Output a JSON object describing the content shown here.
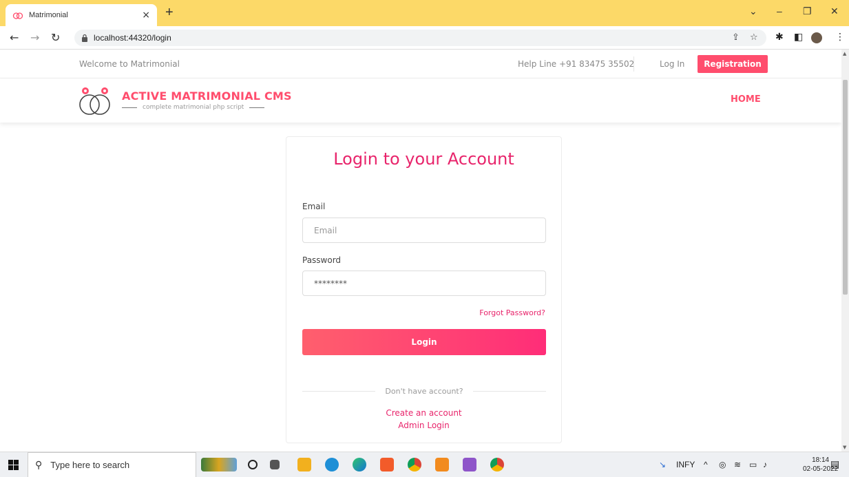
{
  "browser": {
    "tab_title": "Matrimonial",
    "tab_close": "×",
    "new_tab": "+",
    "url": "localhost:44320/login",
    "win_minimize_chevron": "⌄",
    "win_minimize": "–",
    "win_restore": "❐",
    "win_close": "✕"
  },
  "topbar": {
    "welcome": "Welcome to Matrimonial",
    "helpline": "Help Line +91 83475 35502",
    "login_link": "Log In",
    "registration": "Registration"
  },
  "header": {
    "brand": "ACTIVE MATRIMONIAL CMS",
    "tagline": "complete matrimonial php script",
    "nav_home": "HOME"
  },
  "login": {
    "title": "Login to your Account",
    "email_label": "Email",
    "email_placeholder": "Email",
    "password_label": "Password",
    "password_value": "********",
    "forgot": "Forgot Password?",
    "submit": "Login",
    "no_account": "Don't have account?",
    "create_account": "Create an account",
    "admin_login": "Admin Login"
  },
  "taskbar": {
    "search_placeholder": "Type here to search",
    "stock": "INFY",
    "time": "18:14",
    "date": "02-05-2022"
  },
  "colors": {
    "accent": "#ff4d6d",
    "title_pink": "#e8246b",
    "tab_strip": "#fcd968"
  }
}
